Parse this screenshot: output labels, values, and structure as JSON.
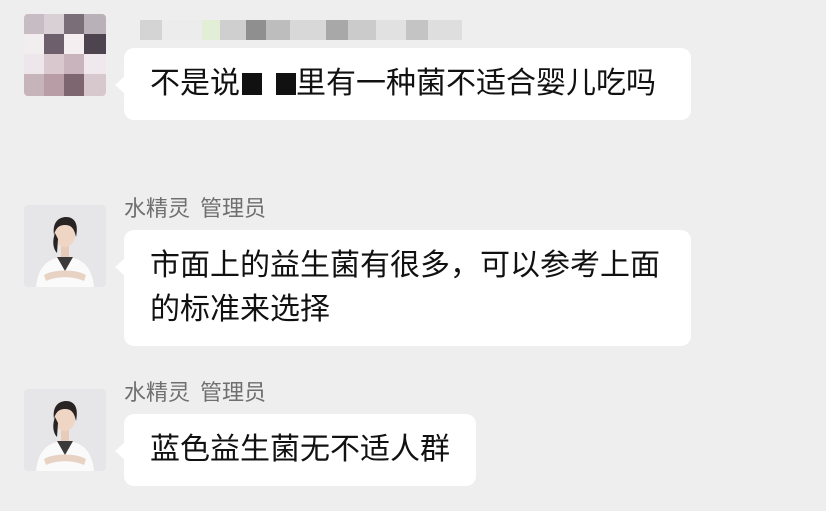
{
  "colors": {
    "background": "#eeeeee",
    "bubble": "#ffffff",
    "name_text": "#6f6f6f",
    "message_text": "#111111"
  },
  "messages": [
    {
      "sender_name": "",
      "sender_role": "",
      "avatar": "pixelated-avatar-icon",
      "text_part1": "不是说",
      "text_part2": "里有一种菌不适合婴儿吃吗",
      "redacted": true
    },
    {
      "sender_name": "水精灵",
      "sender_role": "管理员",
      "avatar": "admin-avatar-icon",
      "text": "市面上的益生菌有很多，可以参考上面的标准来选择"
    },
    {
      "sender_name": "水精灵",
      "sender_role": "管理员",
      "avatar": "admin-avatar-icon",
      "text": "蓝色益生菌无不适人群"
    }
  ]
}
